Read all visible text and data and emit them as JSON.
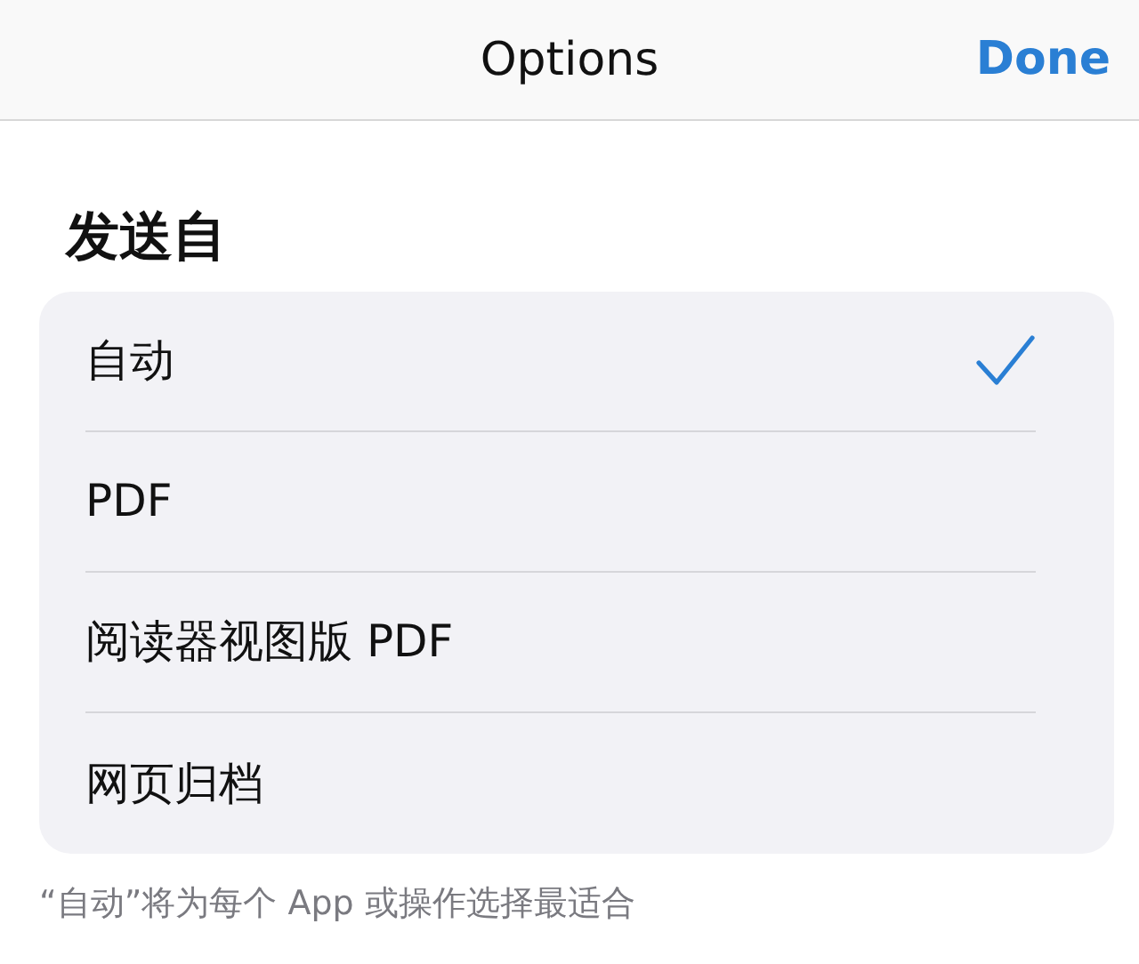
{
  "navbar": {
    "title": "Options",
    "done": "Done"
  },
  "section": {
    "header": "发送自",
    "options": [
      {
        "label": "自动",
        "selected": true
      },
      {
        "label": "PDF",
        "selected": false
      },
      {
        "label": "阅读器视图版 PDF",
        "selected": false
      },
      {
        "label": "网页归档",
        "selected": false
      }
    ],
    "footer": "“自动”将为每个 App 或操作选择最适合"
  }
}
